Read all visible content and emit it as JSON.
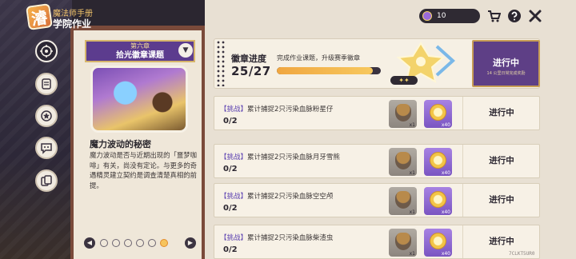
{
  "logo": {
    "badge": "濬",
    "subtitle": "魔法师手册",
    "title": "学院作业"
  },
  "nav": [
    {
      "name": "tasks-nav-icon",
      "active": true
    },
    {
      "name": "scroll-nav-icon",
      "active": false
    },
    {
      "name": "badge-nav-icon",
      "active": false
    },
    {
      "name": "chat-nav-icon",
      "active": false
    },
    {
      "name": "cards-nav-icon",
      "active": false
    }
  ],
  "chapter": {
    "number": "第六章",
    "title": "拾光徽章课题",
    "dropdown": "▼"
  },
  "story": {
    "title": "魔力波动的秘密",
    "text": "魔力波动是否与近期出现的「噩梦咖啡」有关，尚没有定论。与更多的奇遇精灵建立契约是调查清楚真相的前提。"
  },
  "pager": {
    "prev": "◀",
    "next": "▶"
  },
  "topbar": {
    "currency_value": "10"
  },
  "progress": {
    "label": "徽章进度",
    "description": "完成作业课题，升级赛季徽章",
    "count": "25/27",
    "fraction": 0.926,
    "badge_stars": "✦✦",
    "status": "进行中",
    "status_sub": "14 公里日常完成奖励"
  },
  "tasks": [
    {
      "tag": "【挑战】",
      "text": "累计捕捉2只污染血脉粉星仔",
      "count": "0/2",
      "reward1_qty": "x1",
      "reward2_qty": "x40",
      "status": "进行中"
    },
    {
      "tag": "【挑战】",
      "text": "累计捕捉2只污染血脉月牙雪熊",
      "count": "0/2",
      "reward1_qty": "x1",
      "reward2_qty": "x40",
      "status": "进行中"
    },
    {
      "tag": "【挑战】",
      "text": "累计捕捉2只污染血脉空空颅",
      "count": "0/2",
      "reward1_qty": "x1",
      "reward2_qty": "x40",
      "status": "进行中"
    },
    {
      "tag": "【挑战】",
      "text": "累计捕捉2只污染血脉柴渣虫",
      "count": "0/2",
      "reward1_qty": "x1",
      "reward2_qty": "x40",
      "status": "进行中"
    }
  ],
  "watermark": "7CLKT5UR0"
}
